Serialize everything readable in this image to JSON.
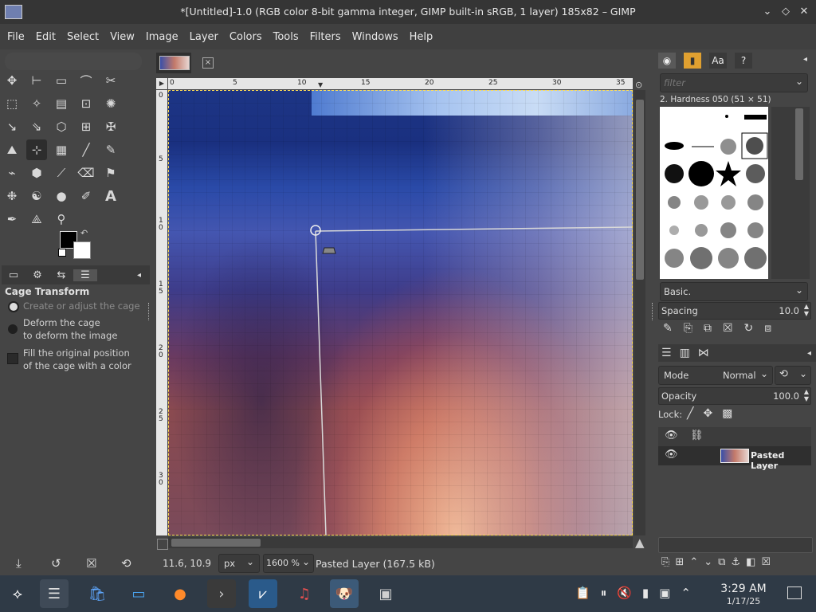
{
  "window": {
    "title": "*[Untitled]-1.0 (RGB color 8-bit gamma integer, GIMP built-in sRGB, 1 layer) 185x82 – GIMP",
    "minimize_glyph": "⌄",
    "maximize_glyph": "◇",
    "close_glyph": "✕"
  },
  "menu": [
    "File",
    "Edit",
    "Select",
    "View",
    "Image",
    "Layer",
    "Colors",
    "Tools",
    "Filters",
    "Windows",
    "Help"
  ],
  "toolbox": {
    "tools": [
      [
        "✥",
        "⊢",
        "▭",
        "⌒",
        "✂"
      ],
      [
        "⬚",
        "✧",
        "▤",
        "⊡",
        "✺"
      ],
      [
        "↘",
        "⇘",
        "⬡",
        "⊞",
        "✠"
      ],
      [
        "⛰",
        "⊹",
        "▦",
        "╱",
        "✎"
      ],
      [
        "⌁",
        "⬢",
        "⟋",
        "⌫",
        "⚑"
      ],
      [
        "❉",
        "☯",
        "●",
        "✐",
        "A"
      ],
      [
        "✒",
        "⟁",
        "⚲"
      ]
    ],
    "options_title": "Cage Transform",
    "option_1": "Create or adjust the cage",
    "option_2a": "Deform the cage",
    "option_2b": "to deform the image",
    "option_3a": "Fill the original position",
    "option_3b": "of the cage with a color"
  },
  "canvas": {
    "ruler_top": [
      "0",
      "5",
      "10",
      "15",
      "20",
      "25",
      "30",
      "35"
    ],
    "ruler_left": [
      "0",
      "5",
      "1\n0",
      "1\n5",
      "2\n0",
      "2\n5",
      "3\n0"
    ]
  },
  "statusbar": {
    "coords": "11.6, 10.9",
    "unit": "px",
    "zoom": "1600 %",
    "layer_info": "Pasted Layer (167.5 kB)"
  },
  "brushes": {
    "filter_placeholder": "filter",
    "brush_name": "2. Hardness 050 (51 × 51)",
    "preset": "Basic.",
    "spacing_label": "Spacing",
    "spacing_value": "10.0"
  },
  "layers": {
    "mode_label": "Mode",
    "mode_value": "Normal",
    "opacity_label": "Opacity",
    "opacity_value": "100.0",
    "lock_label": "Lock:",
    "layer_name": "Pasted Layer"
  },
  "taskbar": {
    "time": "3:29 AM",
    "date": "1/17/25"
  }
}
